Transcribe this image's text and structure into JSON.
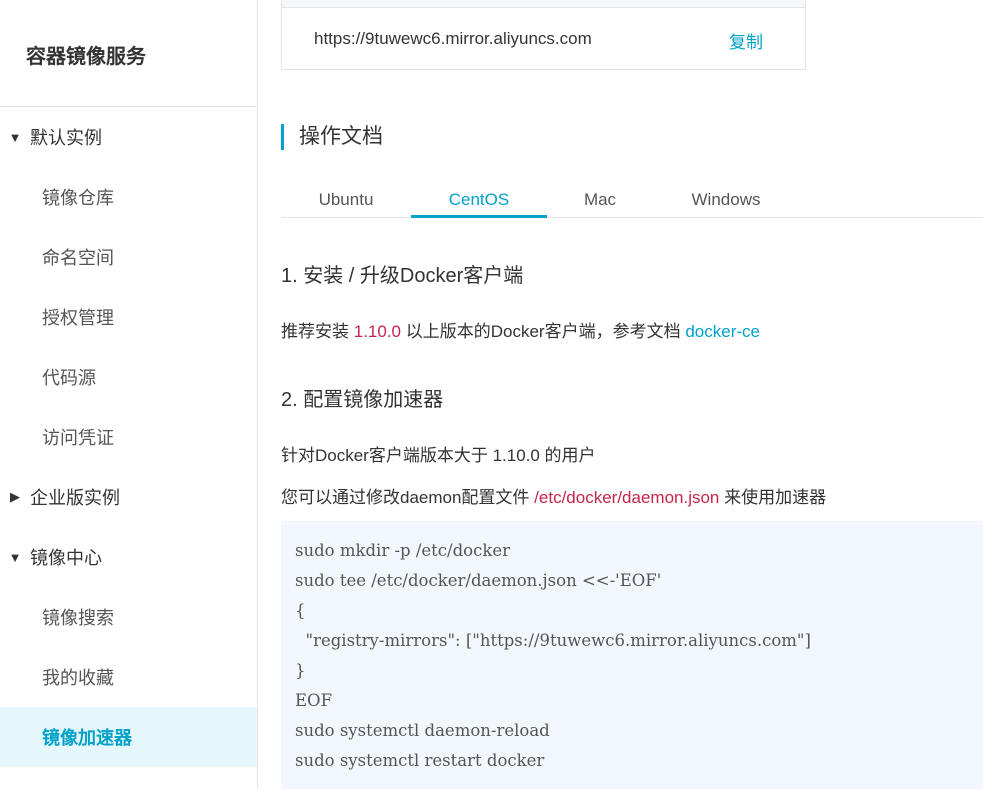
{
  "sidebar": {
    "title": "容器镜像服务",
    "groups": [
      {
        "label": "默认实例",
        "expanded": true,
        "items": [
          "镜像仓库",
          "命名空间",
          "授权管理",
          "代码源",
          "访问凭证"
        ]
      },
      {
        "label": "企业版实例",
        "expanded": false,
        "items": []
      },
      {
        "label": "镜像中心",
        "expanded": true,
        "items": [
          "镜像搜索",
          "我的收藏",
          "镜像加速器"
        ]
      }
    ],
    "active_item": "镜像加速器"
  },
  "accelerator": {
    "url": "https://9tuwewc6.mirror.aliyuncs.com",
    "copy_label": "复制"
  },
  "docs": {
    "title": "操作文档",
    "tabs": [
      "Ubuntu",
      "CentOS",
      "Mac",
      "Windows"
    ],
    "active_tab": "CentOS",
    "step1_title": "1. 安装 / 升级Docker客户端",
    "step1_text_before": "推荐安装",
    "step1_version": "1.10.0",
    "step1_text_after": "以上版本的Docker客户端，参考文档",
    "step1_link": "docker-ce",
    "step2_title": "2. 配置镜像加速器",
    "step2_text1": "针对Docker客户端版本大于 1.10.0 的用户",
    "step2_text2_before": "您可以通过修改daemon配置文件",
    "step2_path": "/etc/docker/daemon.json",
    "step2_text2_after": "来使用加速器",
    "code_lines": [
      "sudo mkdir -p /etc/docker",
      "sudo tee /etc/docker/daemon.json <<-'EOF'",
      "{",
      "  \"registry-mirrors\": [\"https://9tuwewc6.mirror.aliyuncs.com\"]",
      "}",
      "EOF",
      "sudo systemctl daemon-reload",
      "sudo systemctl restart docker"
    ]
  },
  "colors": {
    "accent": "#00a2ca",
    "brand_orange": "#ff6a00",
    "highlight_red": "#c7254e",
    "code_bg": "#f1f7fd",
    "active_bg": "#e6f7fb"
  }
}
